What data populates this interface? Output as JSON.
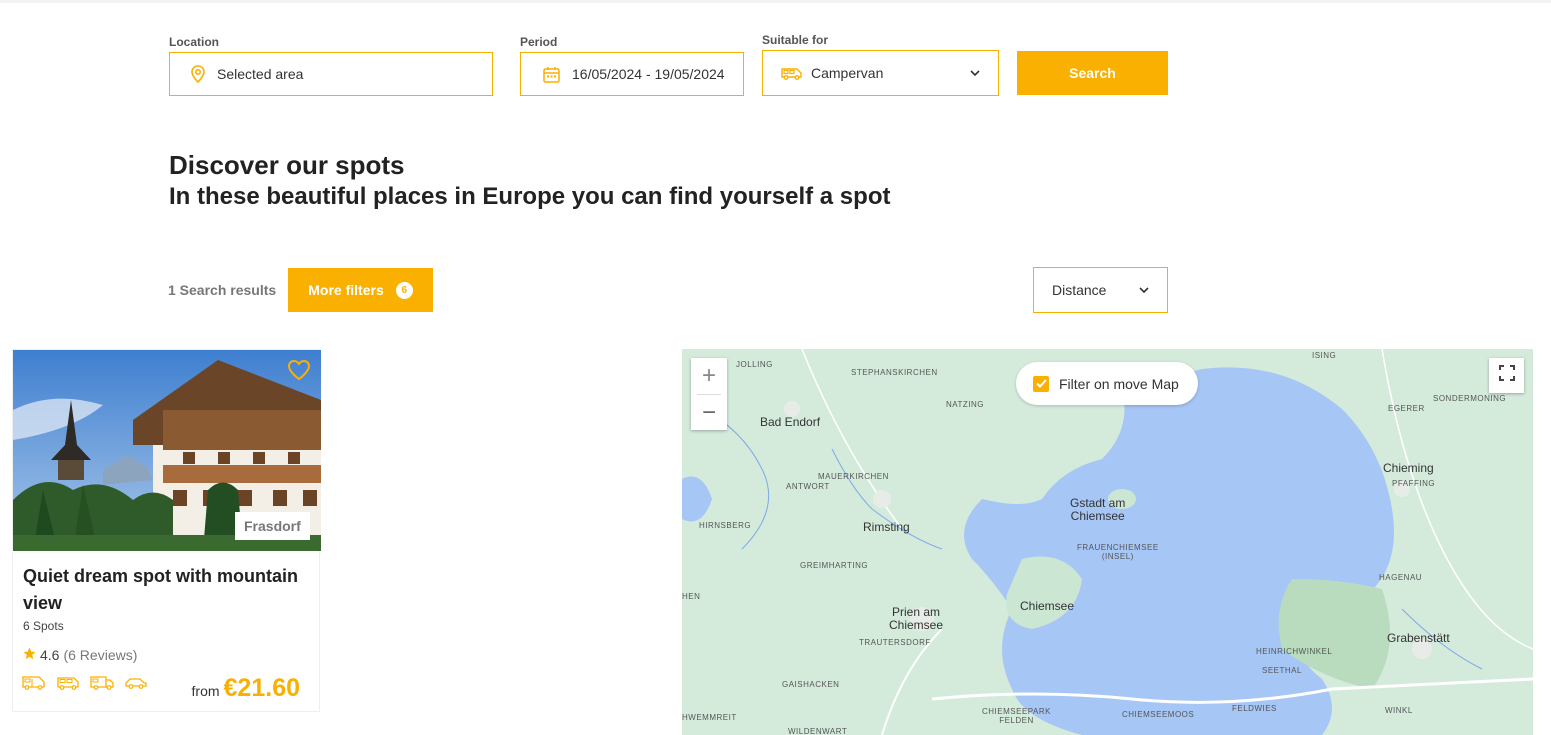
{
  "search": {
    "location_label": "Location",
    "location_value": "Selected area",
    "period_label": "Period",
    "period_value": "16/05/2024 - 19/05/2024",
    "suitable_label": "Suitable for",
    "suitable_value": "Campervan",
    "search_button": "Search"
  },
  "heading": {
    "title": "Discover our spots",
    "subtitle": "In these beautiful places in Europe you can find yourself a spot"
  },
  "toolbar": {
    "results_text": "1 Search results",
    "more_filters_label": "More filters",
    "filter_count": "6",
    "sort_value": "Distance"
  },
  "listing": {
    "place": "Frasdorf",
    "title": "Quiet dream spot with mountain view",
    "spots": "6 Spots",
    "rating": "4.6",
    "reviews": "(6 Reviews)",
    "price_prefix": "from",
    "price": "€21.60",
    "vehicle_icons": [
      "motorhome-icon",
      "van-icon",
      "caravan-icon",
      "car-icon"
    ]
  },
  "map": {
    "filter_on_move": "Filter on move Map",
    "zoom_in": "+",
    "zoom_out": "−",
    "towns": {
      "jolling": "JOLLING",
      "stephanskirchen": "STEPHANSKIRCHEN",
      "natzing": "NATZING",
      "ising": "ISING",
      "sondermoning": "SONDERMONING",
      "egerer": "EGERER",
      "bad_endorf": "Bad Endorf",
      "mauerkirchen": "MAUERKIRCHEN",
      "antwort": "ANTWORT",
      "chieming": "Chieming",
      "pfaffing": "PFAFFING",
      "gstadt": "Gstadt am\nChiemsee",
      "hirnsberg": "HIRNSBERG",
      "rimsting": "Rimsting",
      "frauenchiemsee": "FRAUENCHIEMSEE\n(INSEL)",
      "greimharting": "GREIMHARTING",
      "hagenau": "HAGENAU",
      "chiemsee": "Chiemsee",
      "prien": "Prien am\nChiemsee",
      "grabenstatt": "Grabenstätt",
      "trautersdorf": "TRAUTERSDORF",
      "heinrichwinkel": "HEINRICHWINKEL",
      "seethal": "SEETHAL",
      "gaishacken": "GAISHACKEN",
      "chiemseepark": "CHIEMSEEPARK\nFELDEN",
      "chiemseemoos": "CHIEMSEEMOOS",
      "feldwies": "FELDWIES",
      "winkl": "WINKL",
      "wemmreit": "HWEMMREIT",
      "wildenwart": "WILDENWART",
      "hen": "HEN"
    }
  },
  "colors": {
    "accent": "#f9b000",
    "lake": "#a6c6f5",
    "land": "#cfe8d8"
  }
}
